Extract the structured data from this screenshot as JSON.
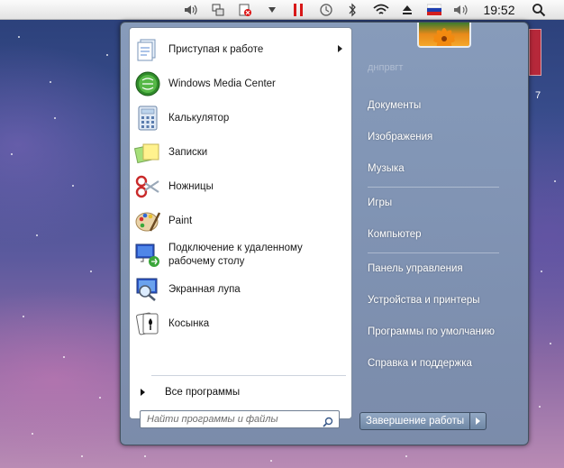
{
  "menubar": {
    "clock": "19:52",
    "icons": [
      "volume-icon",
      "network-monitor-icon",
      "shield-alert-icon",
      "dropdown-arrow-icon",
      "pause-icon",
      "time-machine-icon",
      "bluetooth-icon",
      "wifi-icon",
      "eject-icon",
      "russian-flag-icon",
      "speaker-icon",
      "spotlight-search-icon"
    ]
  },
  "desktop": {
    "side_number": "7"
  },
  "start_menu": {
    "programs": [
      {
        "label": "Приступая к работе",
        "icon": "getting-started-icon",
        "has_submenu": true
      },
      {
        "label": "Windows Media Center",
        "icon": "media-center-icon",
        "has_submenu": false
      },
      {
        "label": "Калькулятор",
        "icon": "calculator-icon",
        "has_submenu": false
      },
      {
        "label": "Записки",
        "icon": "sticky-notes-icon",
        "has_submenu": false
      },
      {
        "label": "Ножницы",
        "icon": "scissors-icon",
        "has_submenu": false
      },
      {
        "label": "Paint",
        "icon": "paint-palette-icon",
        "has_submenu": false
      },
      {
        "label": "Подключение к удаленному рабочему столу",
        "line1": "Подключение к удаленному",
        "line2": "рабочему столу",
        "icon": "remote-desktop-icon",
        "has_submenu": false
      },
      {
        "label": "Экранная лупа",
        "icon": "magnifier-icon",
        "has_submenu": false
      },
      {
        "label": "Косынка",
        "icon": "solitaire-icon",
        "has_submenu": false
      }
    ],
    "all_programs": "Все программы",
    "search_placeholder": "Найти программы и файлы",
    "user_name": "днпрвгт",
    "right_items": [
      {
        "label": "Документы"
      },
      {
        "label": "Изображения"
      },
      {
        "label": "Музыка"
      },
      {
        "label": "Игры"
      },
      {
        "label": "Компьютер"
      },
      {
        "label": "Панель управления"
      },
      {
        "label": "Устройства и принтеры"
      },
      {
        "label": "Программы по умолчанию"
      },
      {
        "label": "Справка и поддержка"
      }
    ],
    "shutdown": "Завершение работы"
  }
}
